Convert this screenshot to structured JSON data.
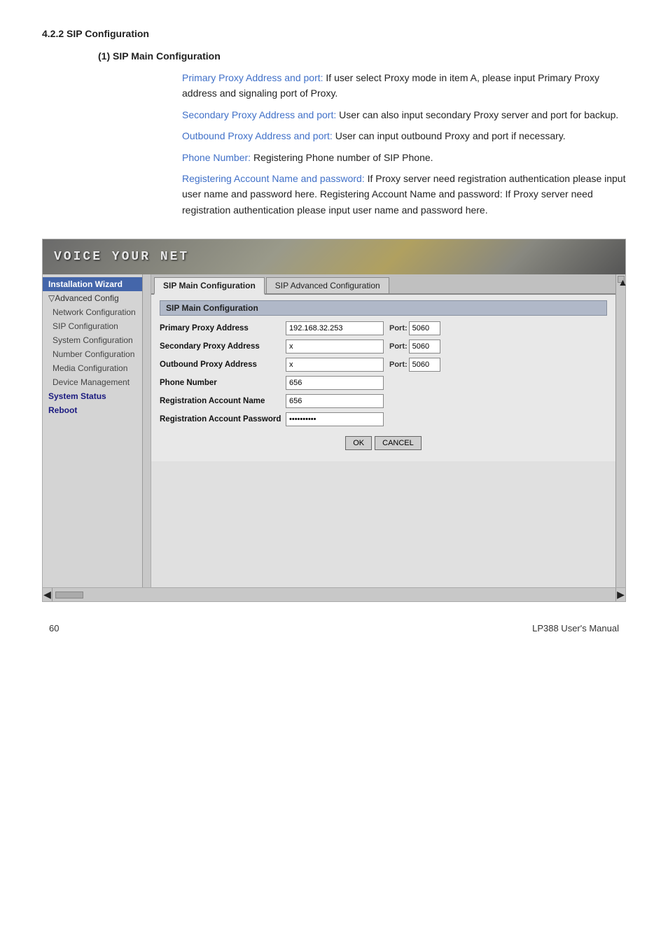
{
  "doc": {
    "heading": "4.2.2 SIP Configuration",
    "subheading": "(1) SIP Main Configuration",
    "paragraphs": [
      {
        "label": "Primary Proxy Address and port:",
        "text": " If user select Proxy mode in item A, please input Primary Proxy address and signaling port of Proxy."
      },
      {
        "label": "Secondary Proxy Address and port:",
        "text": " User can also input secondary Proxy server and port for backup."
      },
      {
        "label": "Outbound Proxy Address and port:",
        "text": " User can input outbound Proxy and port if necessary."
      },
      {
        "label": "Phone Number:",
        "text": " Registering Phone number of SIP Phone."
      },
      {
        "label": "Registering Account Name and password:",
        "text": " If Proxy server need registration authentication please input user name and password here. Registering Account Name and password: If Proxy server need registration authentication please input user name and password here."
      }
    ]
  },
  "ui": {
    "header_title": "VOICE YOUR NET",
    "tabs": [
      {
        "label": "SIP Main Configuration",
        "active": true
      },
      {
        "label": "SIP Advanced Configuration",
        "active": false
      }
    ],
    "form_section_title": "SIP Main Configuration",
    "form_fields": [
      {
        "label": "Primary Proxy Address",
        "value": "192.168.32.253",
        "port_label": "Port:",
        "port_value": "5060",
        "has_port": true
      },
      {
        "label": "Secondary Proxy Address",
        "value": "x",
        "port_label": "Port:",
        "port_value": "5060",
        "has_port": true
      },
      {
        "label": "Outbound Proxy Address",
        "value": "x",
        "port_label": "Port:",
        "port_value": "5060",
        "has_port": true
      },
      {
        "label": "Phone Number",
        "value": "656",
        "has_port": false
      },
      {
        "label": "Registration Account Name",
        "value": "656",
        "has_port": false
      },
      {
        "label": "Registration Account Password",
        "value": "**********",
        "has_port": false,
        "is_password": true
      }
    ],
    "buttons": [
      {
        "label": "OK"
      },
      {
        "label": "CANCEL"
      }
    ],
    "sidebar": {
      "items": [
        {
          "label": "Installation Wizard",
          "active": true,
          "indent": false,
          "bold": false
        },
        {
          "label": "▽Advanced Config",
          "active": false,
          "indent": false,
          "bold": false
        },
        {
          "label": "Network Configuration",
          "active": false,
          "indent": true,
          "bold": false
        },
        {
          "label": "SIP Configuration",
          "active": false,
          "indent": true,
          "bold": false
        },
        {
          "label": "System Configuration",
          "active": false,
          "indent": true,
          "bold": false
        },
        {
          "label": "Number Configuration",
          "active": false,
          "indent": true,
          "bold": false
        },
        {
          "label": "Media Configuration",
          "active": false,
          "indent": true,
          "bold": false
        },
        {
          "label": "Device Management",
          "active": false,
          "indent": true,
          "bold": false
        },
        {
          "label": "System Status",
          "active": false,
          "indent": false,
          "bold": true
        },
        {
          "label": "Reboot",
          "active": false,
          "indent": false,
          "bold": true
        }
      ]
    }
  },
  "footer": {
    "page_number": "60",
    "manual_title": "LP388  User's  Manual"
  }
}
